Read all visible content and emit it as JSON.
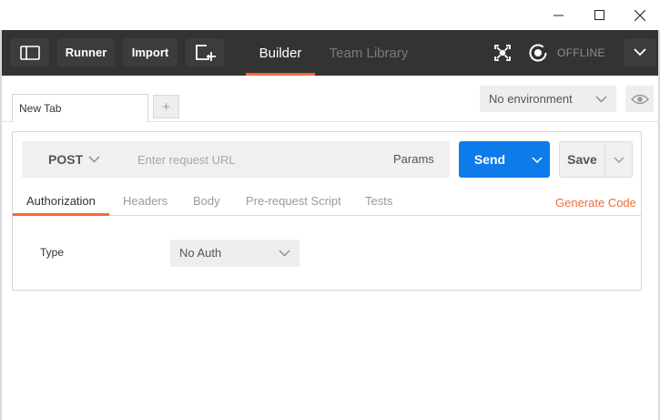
{
  "toolbar": {
    "runner_label": "Runner",
    "import_label": "Import",
    "tabs": [
      {
        "label": "Builder",
        "active": true
      },
      {
        "label": "Team Library",
        "active": false
      }
    ],
    "sync_status": "OFFLINE"
  },
  "tabstrip": {
    "tabs": [
      {
        "label": "New Tab"
      }
    ],
    "add_label": "+"
  },
  "environment": {
    "selected": "No environment"
  },
  "request": {
    "method": "POST",
    "url_value": "",
    "url_placeholder": "Enter request URL",
    "params_label": "Params",
    "send_label": "Send",
    "save_label": "Save",
    "subtabs": [
      {
        "label": "Authorization",
        "active": true
      },
      {
        "label": "Headers",
        "active": false
      },
      {
        "label": "Body",
        "active": false
      },
      {
        "label": "Pre-request Script",
        "active": false
      },
      {
        "label": "Tests",
        "active": false
      }
    ],
    "generate_code_label": "Generate Code"
  },
  "auth": {
    "type_label": "Type",
    "selected": "No Auth"
  },
  "colors": {
    "accent": "#f26b3a",
    "send_blue": "#0d7bea",
    "toolbar_bg": "#333333"
  },
  "icons": {
    "sidebar_toggle": "sidebar-toggle-icon",
    "new_window": "new-window-icon",
    "interceptor": "interceptor-icon",
    "sync": "sync-icon",
    "menu": "chevron-down-icon",
    "eye": "eye-icon"
  }
}
